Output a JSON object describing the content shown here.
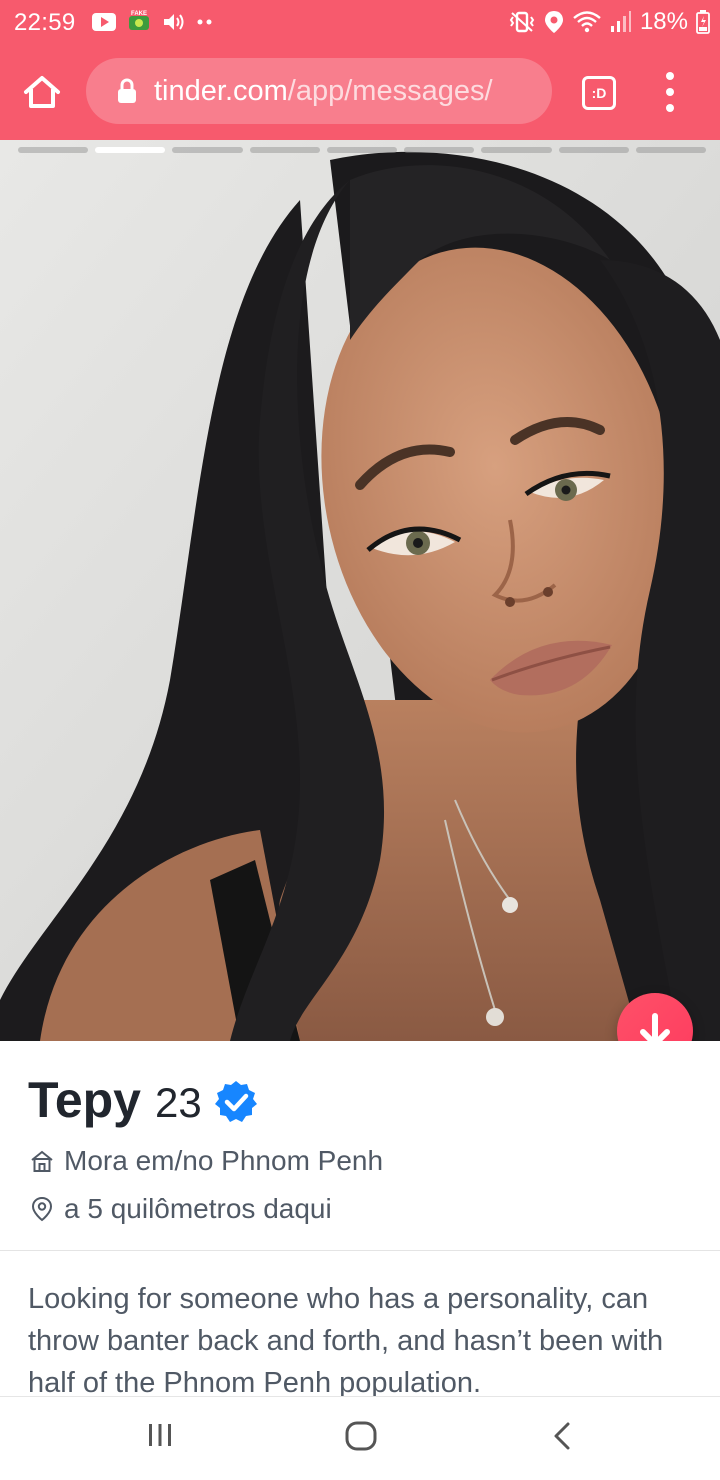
{
  "status_bar": {
    "time": "22:59",
    "battery": "18%",
    "icons_left": [
      "youtube-icon",
      "fake-gps-icon",
      "volume-icon",
      "more-dots-icon"
    ],
    "icons_right": [
      "vibrate-icon",
      "location-icon",
      "wifi-icon",
      "signal-icon",
      "battery-icon"
    ]
  },
  "browser": {
    "url_host": "tinder.com",
    "url_path": "/app/messages/",
    "tabs_label": ":D"
  },
  "profile": {
    "photo_count": 9,
    "active_photo": 2,
    "name": "Tepy",
    "age": "23",
    "verified": true,
    "lives_in": "Mora em/no Phnom Penh",
    "distance": "a 5 quilômetros daqui",
    "bio": "Looking for someone who has a personality, can throw banter back and forth, and hasn’t been with half of the Phnom Penh population."
  },
  "colors": {
    "accent": "#f75a6d",
    "fab": "#fd5068",
    "verified": "#1786ff",
    "text_dark": "#21262e",
    "text_muted": "#505965"
  },
  "navbar": {
    "buttons": [
      "recent-apps-icon",
      "home-icon",
      "back-icon"
    ]
  }
}
